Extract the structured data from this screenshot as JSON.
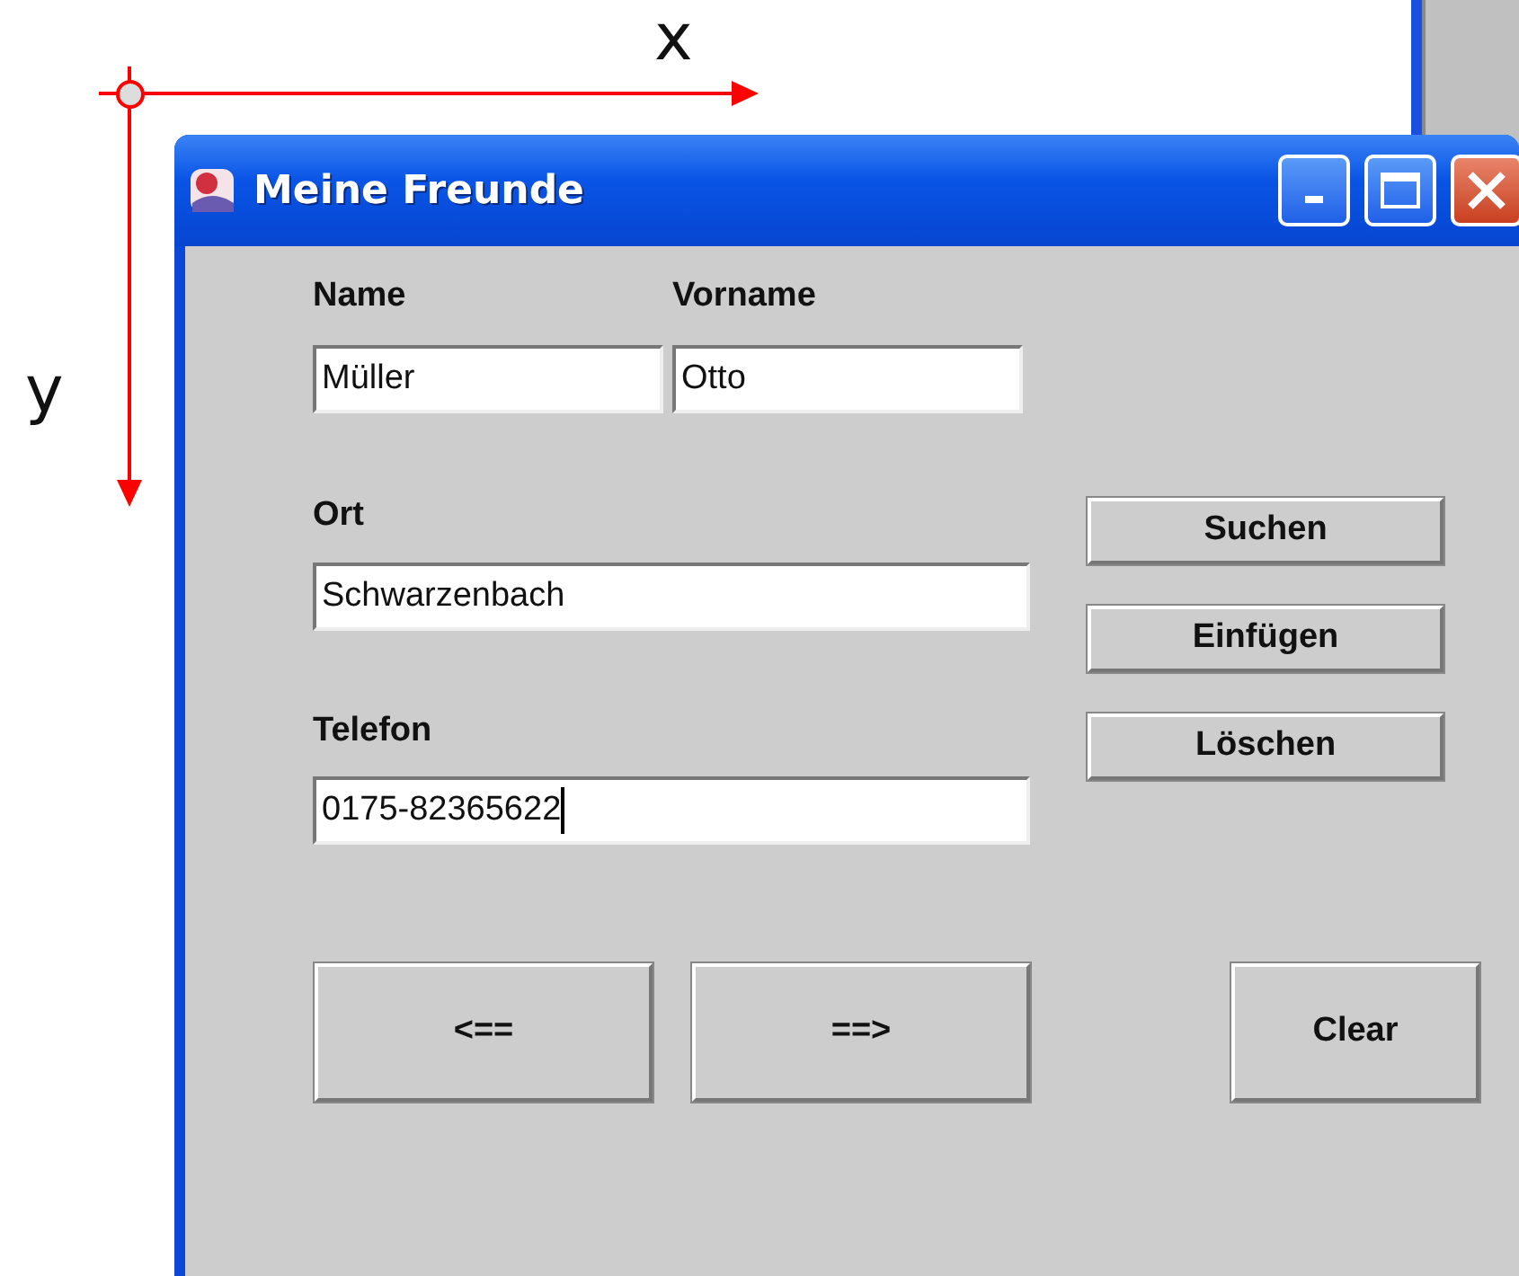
{
  "axes": {
    "x_label": "x",
    "y_label": "y"
  },
  "window": {
    "title": "Meine Freunde"
  },
  "fields": [
    {
      "label": "Name",
      "value": "Müller",
      "focused": false
    },
    {
      "label": "Vorname",
      "value": "Otto",
      "focused": false
    },
    {
      "label": "Ort",
      "value": "Schwarzenbach",
      "focused": false
    },
    {
      "label": "Telefon",
      "value": "0175-82365622",
      "focused": true
    }
  ],
  "side_buttons": [
    "Suchen",
    "Einfügen",
    "Löschen"
  ],
  "bottom_buttons": [
    "<==",
    "==>",
    "Clear"
  ]
}
